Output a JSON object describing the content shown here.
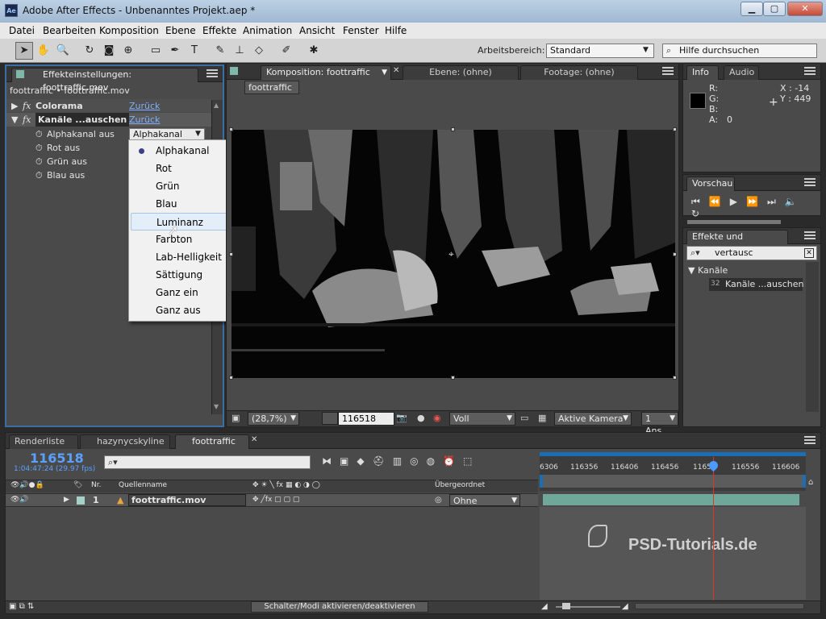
{
  "window": {
    "title": "Adobe After Effects - Unbenanntes Projekt.aep *",
    "app_icon": "Ae"
  },
  "menu": [
    "Datei",
    "Bearbeiten",
    "Komposition",
    "Ebene",
    "Effekte",
    "Animation",
    "Ansicht",
    "Fenster",
    "Hilfe"
  ],
  "toolbar": {
    "workspace_label": "Arbeitsbereich:",
    "workspace_value": "Standard",
    "help_placeholder": "Hilfe durchsuchen"
  },
  "effects_panel": {
    "tab": "Effekteinstellungen: foottraffic.mov",
    "breadcrumb": "foottraffic • foottraffic.mov",
    "effects": [
      {
        "name": "Colorama",
        "reset": "Zurück"
      },
      {
        "name": "Kanäle ...auschen",
        "reset": "Zurück"
      }
    ],
    "params": [
      {
        "label": "Alphakanal aus",
        "value": "Alphakanal"
      },
      {
        "label": "Rot aus"
      },
      {
        "label": "Grün aus"
      },
      {
        "label": "Blau aus"
      }
    ],
    "dropdown": [
      "Alphakanal",
      "Rot",
      "Grün",
      "Blau",
      "Luminanz",
      "Farbton",
      "Lab-Helligkeit",
      "Sättigung",
      "Ganz ein",
      "Ganz aus"
    ],
    "dropdown_selected": "Alphakanal",
    "dropdown_hover": "Luminanz"
  },
  "comp_panel": {
    "tab_comp": "Komposition: foottraffic",
    "tab_layer": "Ebene: (ohne)",
    "tab_footage": "Footage: (ohne)",
    "comp_button": "foottraffic",
    "zoom": "(28,7%)",
    "timecode": "116518",
    "quality": "Voll",
    "camera": "Aktive Kamera",
    "views": "1 Ans..."
  },
  "info_panel": {
    "tab_info": "Info",
    "tab_audio": "Audio",
    "r_label": "R:",
    "g_label": "G:",
    "b_label": "B:",
    "a_label": "A:",
    "a_value": "0",
    "x": "X : -14",
    "y": "Y : 449"
  },
  "preview_panel": {
    "tab": "Vorschau"
  },
  "effects_presets": {
    "tab": "Effekte und Vorgaben",
    "search": "vertausc",
    "category": "Kanäle",
    "item": "Kanäle ...auschen"
  },
  "timeline": {
    "tabs": [
      "Renderliste",
      "hazynycskyline",
      "foottraffic"
    ],
    "timecode": "116518",
    "timecode_sub": "1:04:47:24 (29.97 fps)",
    "col_nr": "Nr.",
    "col_source": "Quellenname",
    "col_parent": "Übergeordnet",
    "layer_nr": "1",
    "layer_name": "foottraffic.mov",
    "layer_parent": "Ohne",
    "ruler": [
      "6306",
      "116356",
      "116406",
      "116456",
      "1165",
      "116556",
      "116606"
    ],
    "toggle_modes": "Schalter/Modi aktivieren/deaktivieren",
    "watermark": "PSD-Tutorials.de"
  },
  "colors": {
    "accent": "#1a6eb5",
    "playhead": "#e0342a",
    "layer_bar": "#6fa89a"
  }
}
